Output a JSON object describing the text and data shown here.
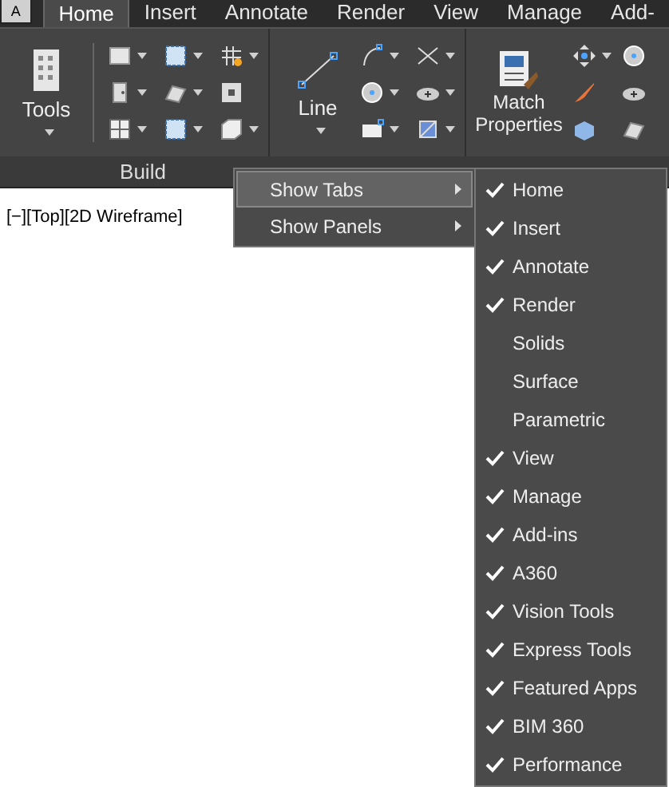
{
  "app_button": {
    "label": "A"
  },
  "tabs": [
    {
      "label": "Home",
      "selected": true
    },
    {
      "label": "Insert",
      "selected": false
    },
    {
      "label": "Annotate",
      "selected": false
    },
    {
      "label": "Render",
      "selected": false
    },
    {
      "label": "View",
      "selected": false
    },
    {
      "label": "Manage",
      "selected": false
    },
    {
      "label": "Add-",
      "selected": false
    }
  ],
  "ribbon": {
    "tools_label": "Tools",
    "line_label": "Line",
    "match_label": "Match Properties",
    "panel_title": "Build"
  },
  "viewport": {
    "label": "[−][Top][2D Wireframe]"
  },
  "context_menu": {
    "items": [
      {
        "label": "Show Tabs",
        "selected": true
      },
      {
        "label": "Show Panels",
        "selected": false
      }
    ]
  },
  "submenu": {
    "items": [
      {
        "label": "Home",
        "checked": true
      },
      {
        "label": "Insert",
        "checked": true
      },
      {
        "label": "Annotate",
        "checked": true
      },
      {
        "label": "Render",
        "checked": true
      },
      {
        "label": "Solids",
        "checked": false
      },
      {
        "label": "Surface",
        "checked": false
      },
      {
        "label": "Parametric",
        "checked": false
      },
      {
        "label": "View",
        "checked": true
      },
      {
        "label": "Manage",
        "checked": true
      },
      {
        "label": "Add-ins",
        "checked": true
      },
      {
        "label": "A360",
        "checked": true
      },
      {
        "label": "Vision Tools",
        "checked": true
      },
      {
        "label": "Express Tools",
        "checked": true
      },
      {
        "label": "Featured Apps",
        "checked": true
      },
      {
        "label": "BIM 360",
        "checked": true
      },
      {
        "label": "Performance",
        "checked": true
      }
    ]
  }
}
